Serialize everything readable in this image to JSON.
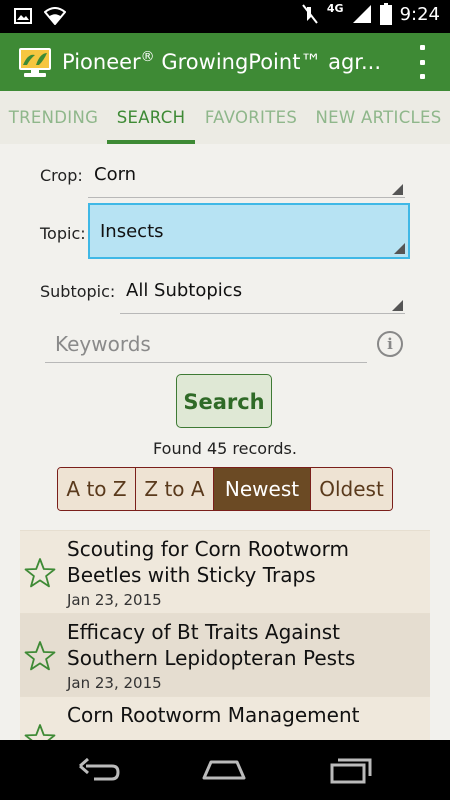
{
  "status_bar": {
    "network_type": "4G",
    "time": "9:24",
    "icons": [
      "image-icon",
      "wifi-icon",
      "mute-icon",
      "signal-icon",
      "battery-icon"
    ]
  },
  "app": {
    "title": "Pioneer",
    "registered_mark": "®",
    "title_rest": " GrowingPoint™ agr...",
    "colors": {
      "primary": "#3e8a35",
      "tab_inactive": "#8fb78b",
      "sort_selected": "#6b4a24",
      "focus_blue": "#b7e3f3"
    }
  },
  "tabs": [
    {
      "label": "TRENDING"
    },
    {
      "label": "SEARCH",
      "active": true
    },
    {
      "label": "FAVORITES"
    },
    {
      "label": "NEW ARTICLES"
    }
  ],
  "filters": {
    "crop": {
      "label": "Crop:",
      "value": "Corn"
    },
    "topic": {
      "label": "Topic:",
      "value": "Insects"
    },
    "subtopic": {
      "label": "Subtopic:",
      "value": "All Subtopics"
    }
  },
  "keywords": {
    "placeholder": "Keywords"
  },
  "search_button": "Search",
  "result_count_text": "Found 45 records.",
  "sort_options": [
    {
      "label": "A to Z"
    },
    {
      "label": "Z to A"
    },
    {
      "label": "Newest",
      "selected": true
    },
    {
      "label": "Oldest"
    }
  ],
  "articles": [
    {
      "title": "Scouting for Corn Rootworm Beetles with Sticky Traps",
      "date": "Jan 23, 2015"
    },
    {
      "title": "Efficacy of Bt Traits Against Southern Lepidopteran Pests",
      "date": "Jan 23, 2015"
    },
    {
      "title": "Corn Rootworm Management",
      "date": ""
    }
  ]
}
